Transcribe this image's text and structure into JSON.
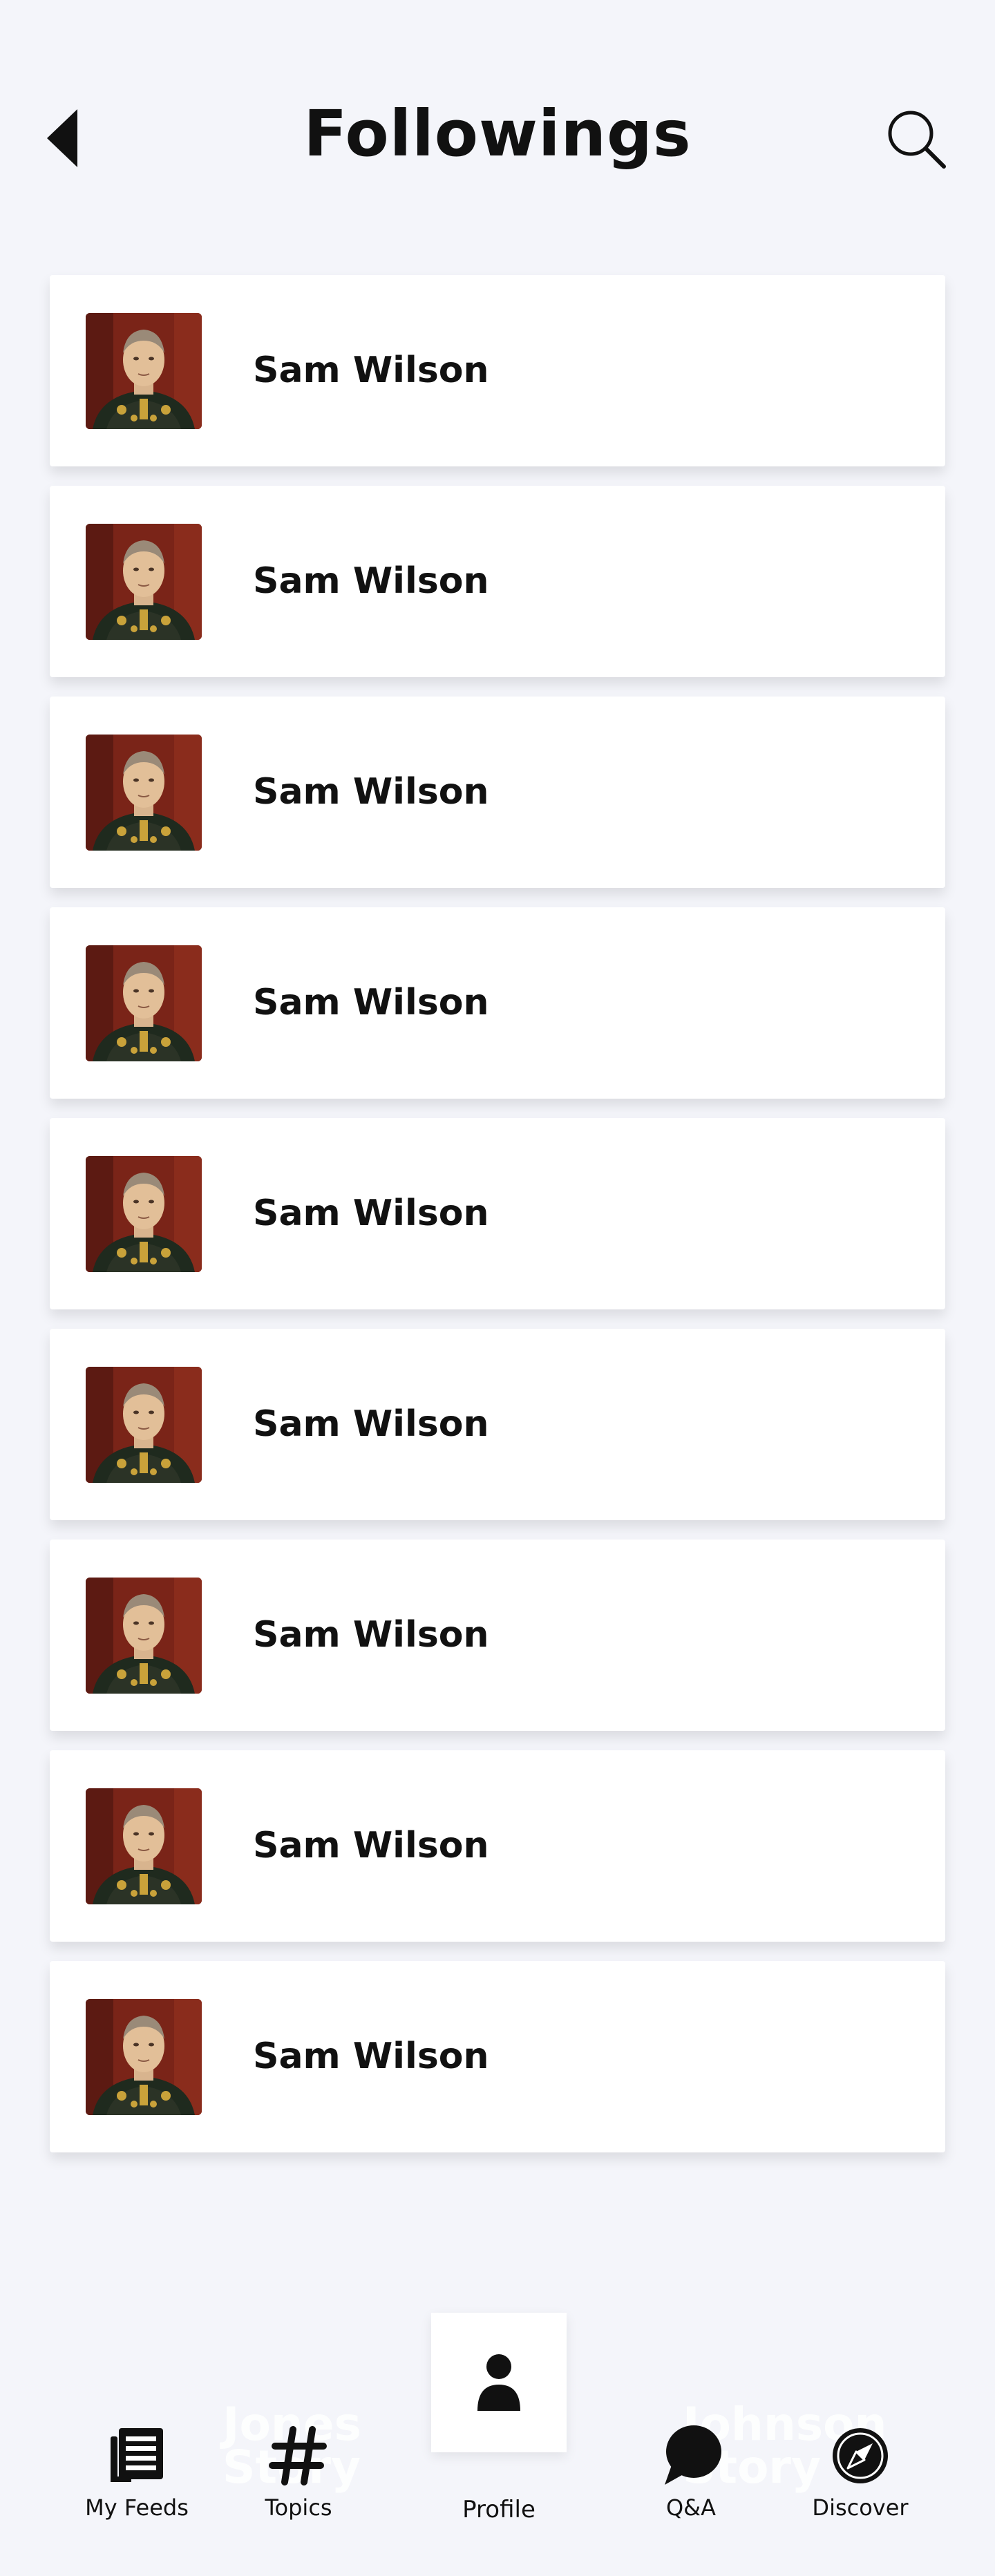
{
  "header": {
    "title": "Followings",
    "back_icon": "back-arrow-icon",
    "search_icon": "search-icon"
  },
  "followings": [
    {
      "name": "Sam Wilson"
    },
    {
      "name": "Sam Wilson"
    },
    {
      "name": "Sam Wilson"
    },
    {
      "name": "Sam Wilson"
    },
    {
      "name": "Sam Wilson"
    },
    {
      "name": "Sam Wilson"
    },
    {
      "name": "Sam Wilson"
    },
    {
      "name": "Sam Wilson"
    },
    {
      "name": "Sam Wilson"
    }
  ],
  "bottom_nav": {
    "watermark_left": [
      "Jones",
      "Story"
    ],
    "watermark_right": [
      "Johnson",
      "Story"
    ],
    "items": [
      {
        "label": "My Feeds",
        "icon": "feed-icon"
      },
      {
        "label": "Topics",
        "icon": "hashtag-icon"
      },
      {
        "label": "Profile",
        "icon": "person-icon"
      },
      {
        "label": "Q&A",
        "icon": "chat-bubble-icon"
      },
      {
        "label": "Discover",
        "icon": "compass-icon"
      }
    ]
  },
  "colors": {
    "background": "#f4f5fa",
    "card": "#ffffff",
    "text": "#111111"
  }
}
